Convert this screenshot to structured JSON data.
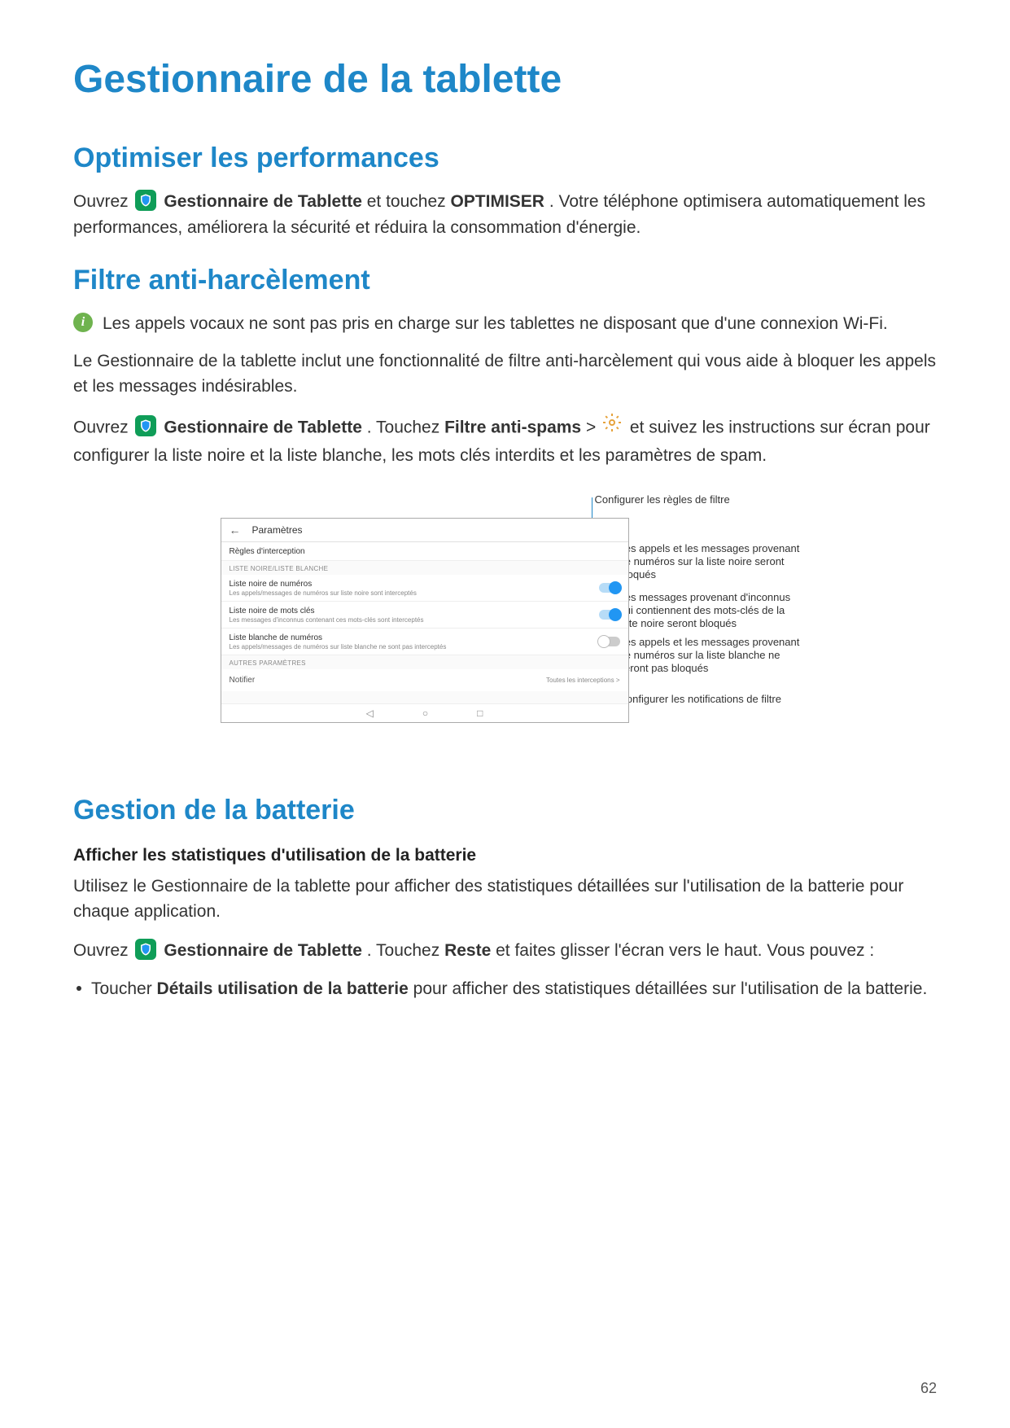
{
  "page_title": "Gestionnaire de la tablette",
  "page_number": "62",
  "sections": {
    "optimize": {
      "heading": "Optimiser les performances",
      "p1_pre": "Ouvrez ",
      "app_label": "Gestionnaire de Tablette",
      "p1_mid": " et touchez ",
      "btn_label": "OPTIMISER",
      "p1_post": ". Votre téléphone optimisera automatiquement les performances, améliorera la sécurité et réduira la consommation d'énergie."
    },
    "filter": {
      "heading": "Filtre anti-harcèlement",
      "note": "Les appels vocaux ne sont pas pris en charge sur les tablettes ne disposant que d'une connexion Wi-Fi.",
      "p1": "Le Gestionnaire de la tablette inclut une fonctionnalité de filtre anti-harcèlement qui vous aide à bloquer les appels et les messages indésirables.",
      "p2_pre": "Ouvrez ",
      "app_label": "Gestionnaire de Tablette",
      "p2_mid": ". Touchez ",
      "spam_label": "Filtre anti-spams",
      "gt": " > ",
      "p2_post": " et suivez les instructions sur écran pour configurer la liste noire et la liste blanche, les mots clés interdits et les paramètres de spam."
    },
    "battery": {
      "heading": "Gestion de la batterie",
      "sub1": "Afficher les statistiques d'utilisation de la batterie",
      "p1": "Utilisez le Gestionnaire de la tablette pour afficher des statistiques détaillées sur l'utilisation de la batterie pour chaque application.",
      "p2_pre": "Ouvrez ",
      "app_label": "Gestionnaire de Tablette",
      "p2_mid": ". Touchez ",
      "reste_label": "Reste",
      "p2_post": " et faites glisser l'écran vers le haut. Vous pouvez :",
      "bullet1_pre": "Toucher ",
      "bullet1_bold": "Détails utilisation de la batterie",
      "bullet1_post": " pour afficher des statistiques détaillées sur l'utilisation de la batterie."
    }
  },
  "screenshot": {
    "header": "Paramètres",
    "rows": {
      "rules": {
        "title": "Règles d'interception"
      },
      "section1": "LISTE NOIRE/LISTE BLANCHE",
      "blacklist_num": {
        "title": "Liste noire de numéros",
        "sub": "Les appels/messages de numéros sur liste noire sont interceptés"
      },
      "blacklist_kw": {
        "title": "Liste noire de mots clés",
        "sub": "Les messages d'inconnus contenant ces mots-clés sont interceptés"
      },
      "whitelist_num": {
        "title": "Liste blanche de numéros",
        "sub": "Les appels/messages de numéros sur liste blanche ne sont pas interceptés"
      },
      "section2": "AUTRES PARAMÈTRES",
      "notify": {
        "title": "Notifier",
        "value": "Toutes les interceptions >"
      }
    }
  },
  "callouts": {
    "c1": "Configurer les règles de filtre",
    "c2": "Les appels et les messages provenant de numéros sur la liste noire seront bloqués",
    "c3": "Les messages provenant d'inconnus qui contiennent des mots-clés de la liste noire seront bloqués",
    "c4": "Les appels et les messages provenant de numéros sur la liste blanche ne seront pas bloqués",
    "c5": "Configurer les notifications de filtre"
  }
}
